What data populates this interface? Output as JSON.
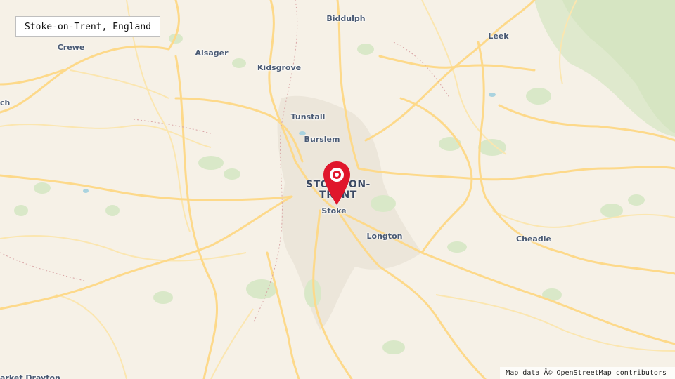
{
  "search": {
    "query": "Stoke-on-Trent, England"
  },
  "city_label": {
    "line1": "STOKE-ON-",
    "line2": "TRENT"
  },
  "places": {
    "biddulph": "Biddulph",
    "leek": "Leek",
    "crewe": "Crewe",
    "alsager": "Alsager",
    "kidsgrove": "Kidsgrove",
    "tunstall": "Tunstall",
    "burslem": "Burslem",
    "stoke": "Stoke",
    "longton": "Longton",
    "cheadle": "Cheadle",
    "nantwich_partial": "ch",
    "market_drayton_partial": "arket Drayton"
  },
  "attribution": "Map data Â© OpenStreetMap contributors",
  "colors": {
    "land": "#f6f1e7",
    "road_major": "#fdd98a",
    "road_minor": "#fbe6b0",
    "urban": "#ece6da",
    "park": "#d9e8c8",
    "moorland": "#cfe0b8",
    "marker": "#e0162b"
  },
  "marker_icon": "map-pin-icon"
}
